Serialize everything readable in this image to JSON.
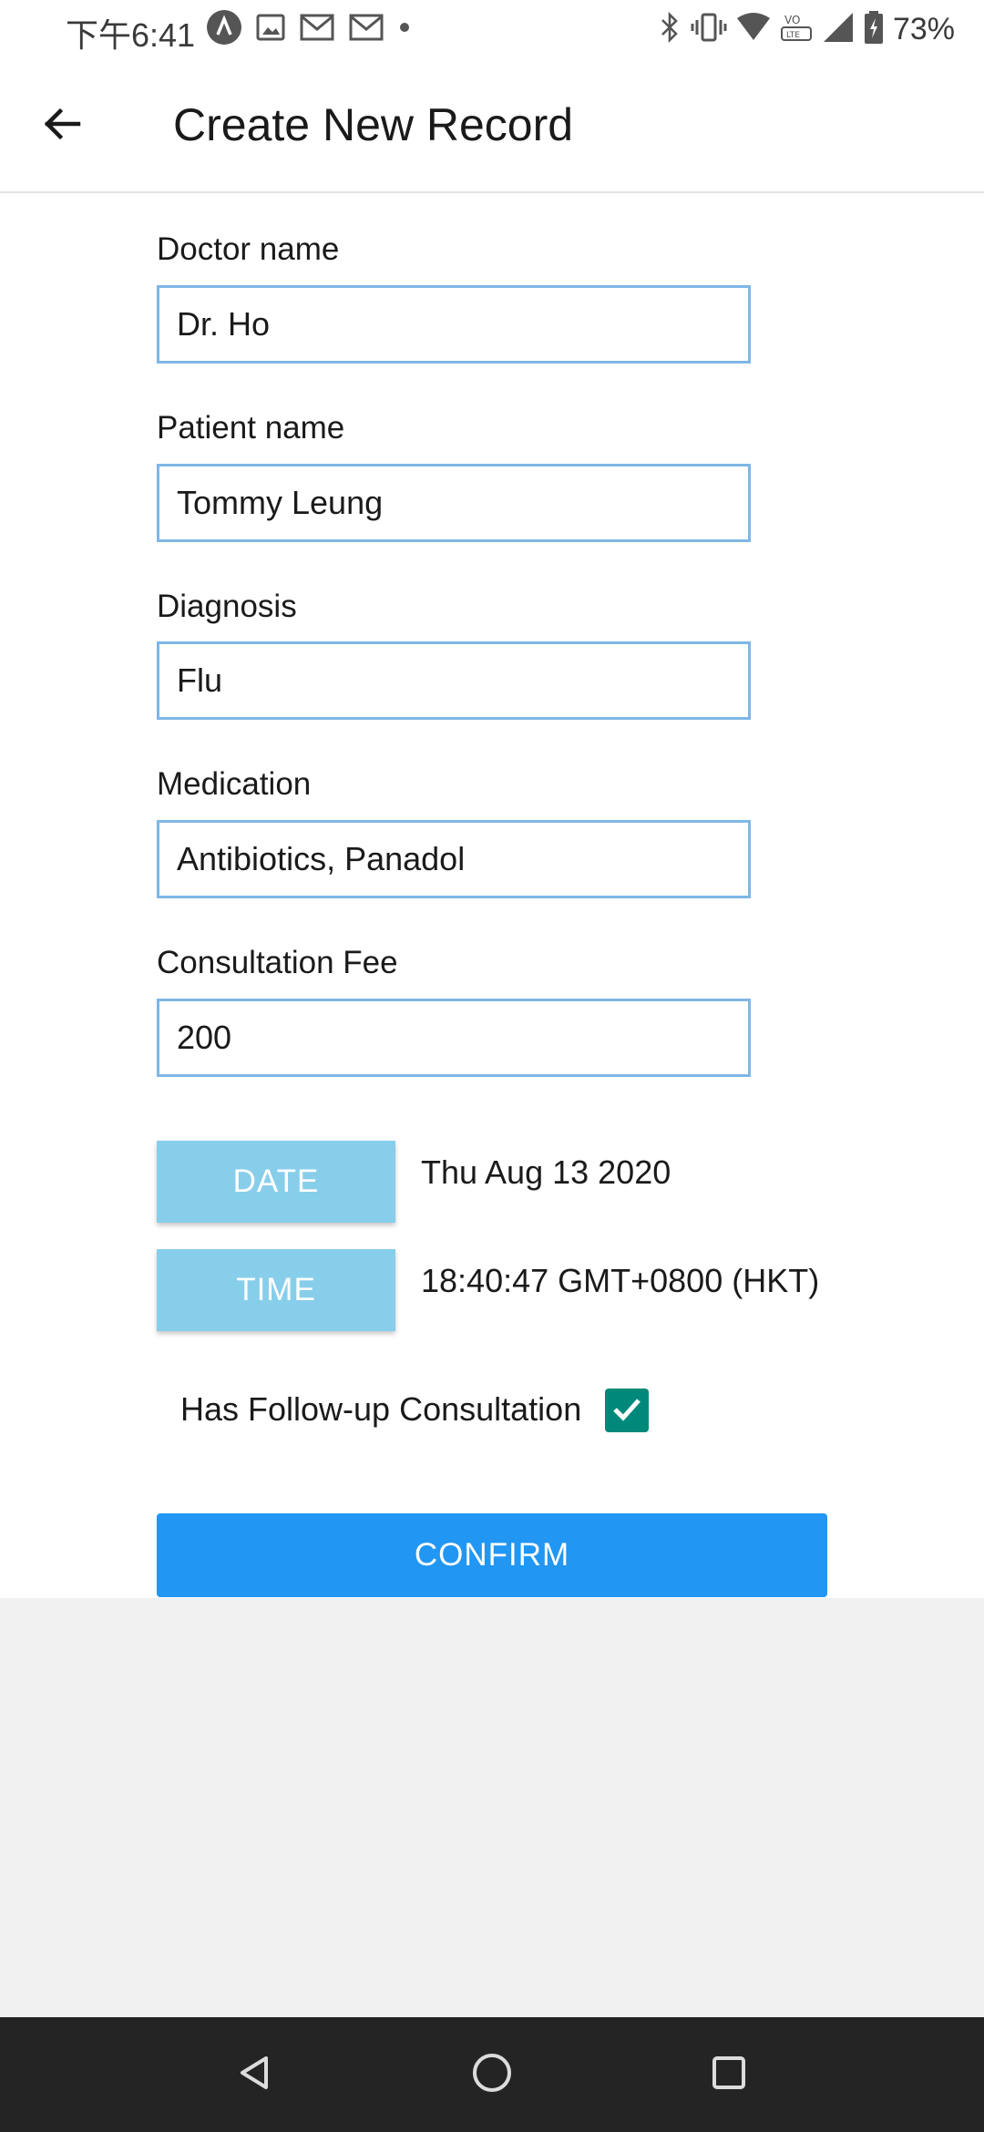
{
  "status_bar": {
    "time": "下午6:41",
    "battery": "73%",
    "left_icons": [
      "app-logo-icon",
      "image-icon",
      "gmail-icon",
      "gmail-icon",
      "dot-icon"
    ],
    "right_icons": [
      "bluetooth-icon",
      "vibrate-icon",
      "wifi-icon",
      "volte-icon",
      "signal-icon",
      "battery-icon"
    ]
  },
  "app_bar": {
    "title": "Create New Record",
    "back_icon": "arrow-back-icon"
  },
  "form": {
    "fields": [
      {
        "label": "Doctor name",
        "value": "Dr. Ho"
      },
      {
        "label": "Patient name",
        "value": "Tommy Leung"
      },
      {
        "label": "Diagnosis",
        "value": "Flu"
      },
      {
        "label": "Medication",
        "value": "Antibiotics, Panadol"
      },
      {
        "label": "Consultation Fee",
        "value": "200"
      }
    ],
    "date_button_label": "DATE",
    "date_value": "Thu Aug 13 2020",
    "time_button_label": "TIME",
    "time_value": "18:40:47 GMT+0800 (HKT)",
    "followup_label": "Has Follow-up Consultation",
    "followup_checked": true,
    "confirm_label": "CONFIRM"
  },
  "colors": {
    "input_border": "#7fb6e6",
    "picker_button": "#87ceeb",
    "confirm_button": "#2196f3",
    "checkbox": "#00897b",
    "nav_bar": "#242424"
  },
  "nav_bar": {
    "buttons": [
      "back-triangle-icon",
      "home-circle-icon",
      "recents-square-icon"
    ]
  }
}
